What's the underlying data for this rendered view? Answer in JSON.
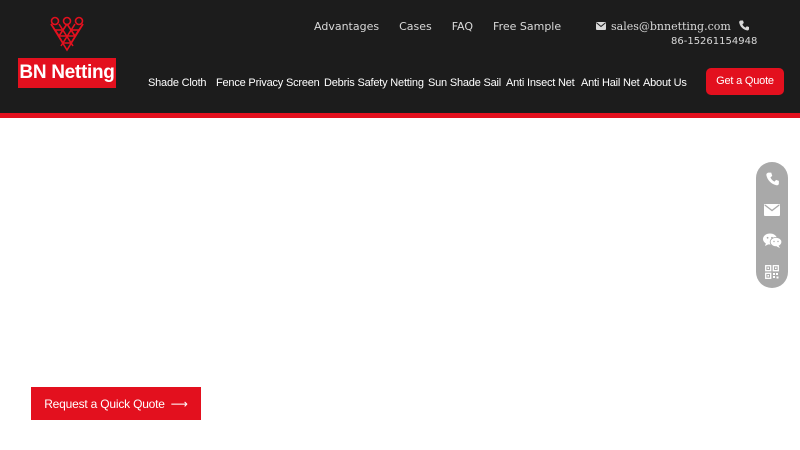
{
  "brand": {
    "name": "BN Netting",
    "accent_color": "#e3101e",
    "header_color": "#1c1c1c",
    "logo_icon": "diamond-net-icon"
  },
  "topnav": {
    "items": [
      {
        "label": "Advantages"
      },
      {
        "label": "Cases"
      },
      {
        "label": "FAQ"
      },
      {
        "label": "Free Sample"
      }
    ]
  },
  "contact": {
    "email": "sales@bnnetting.com",
    "email_icon": "envelope-icon",
    "phone": "86-15261154948",
    "phone_icon": "phone-icon"
  },
  "mainnav": {
    "items": [
      {
        "label": "Shade Cloth"
      },
      {
        "label": "Fence Privacy Screen"
      },
      {
        "label": "Debris Safety Netting"
      },
      {
        "label": "Sun Shade Sail"
      },
      {
        "label": "Anti Insect Net"
      },
      {
        "label": "Anti Hail Net"
      },
      {
        "label": "About Us"
      }
    ],
    "cta_label": "Get a Quote"
  },
  "sidebar": {
    "icons": [
      "phone-icon",
      "envelope-icon",
      "wechat-icon",
      "qr-code-icon"
    ]
  },
  "hero": {
    "cta_label": "Request a Quick Quote",
    "cta_arrow": "⟶"
  }
}
